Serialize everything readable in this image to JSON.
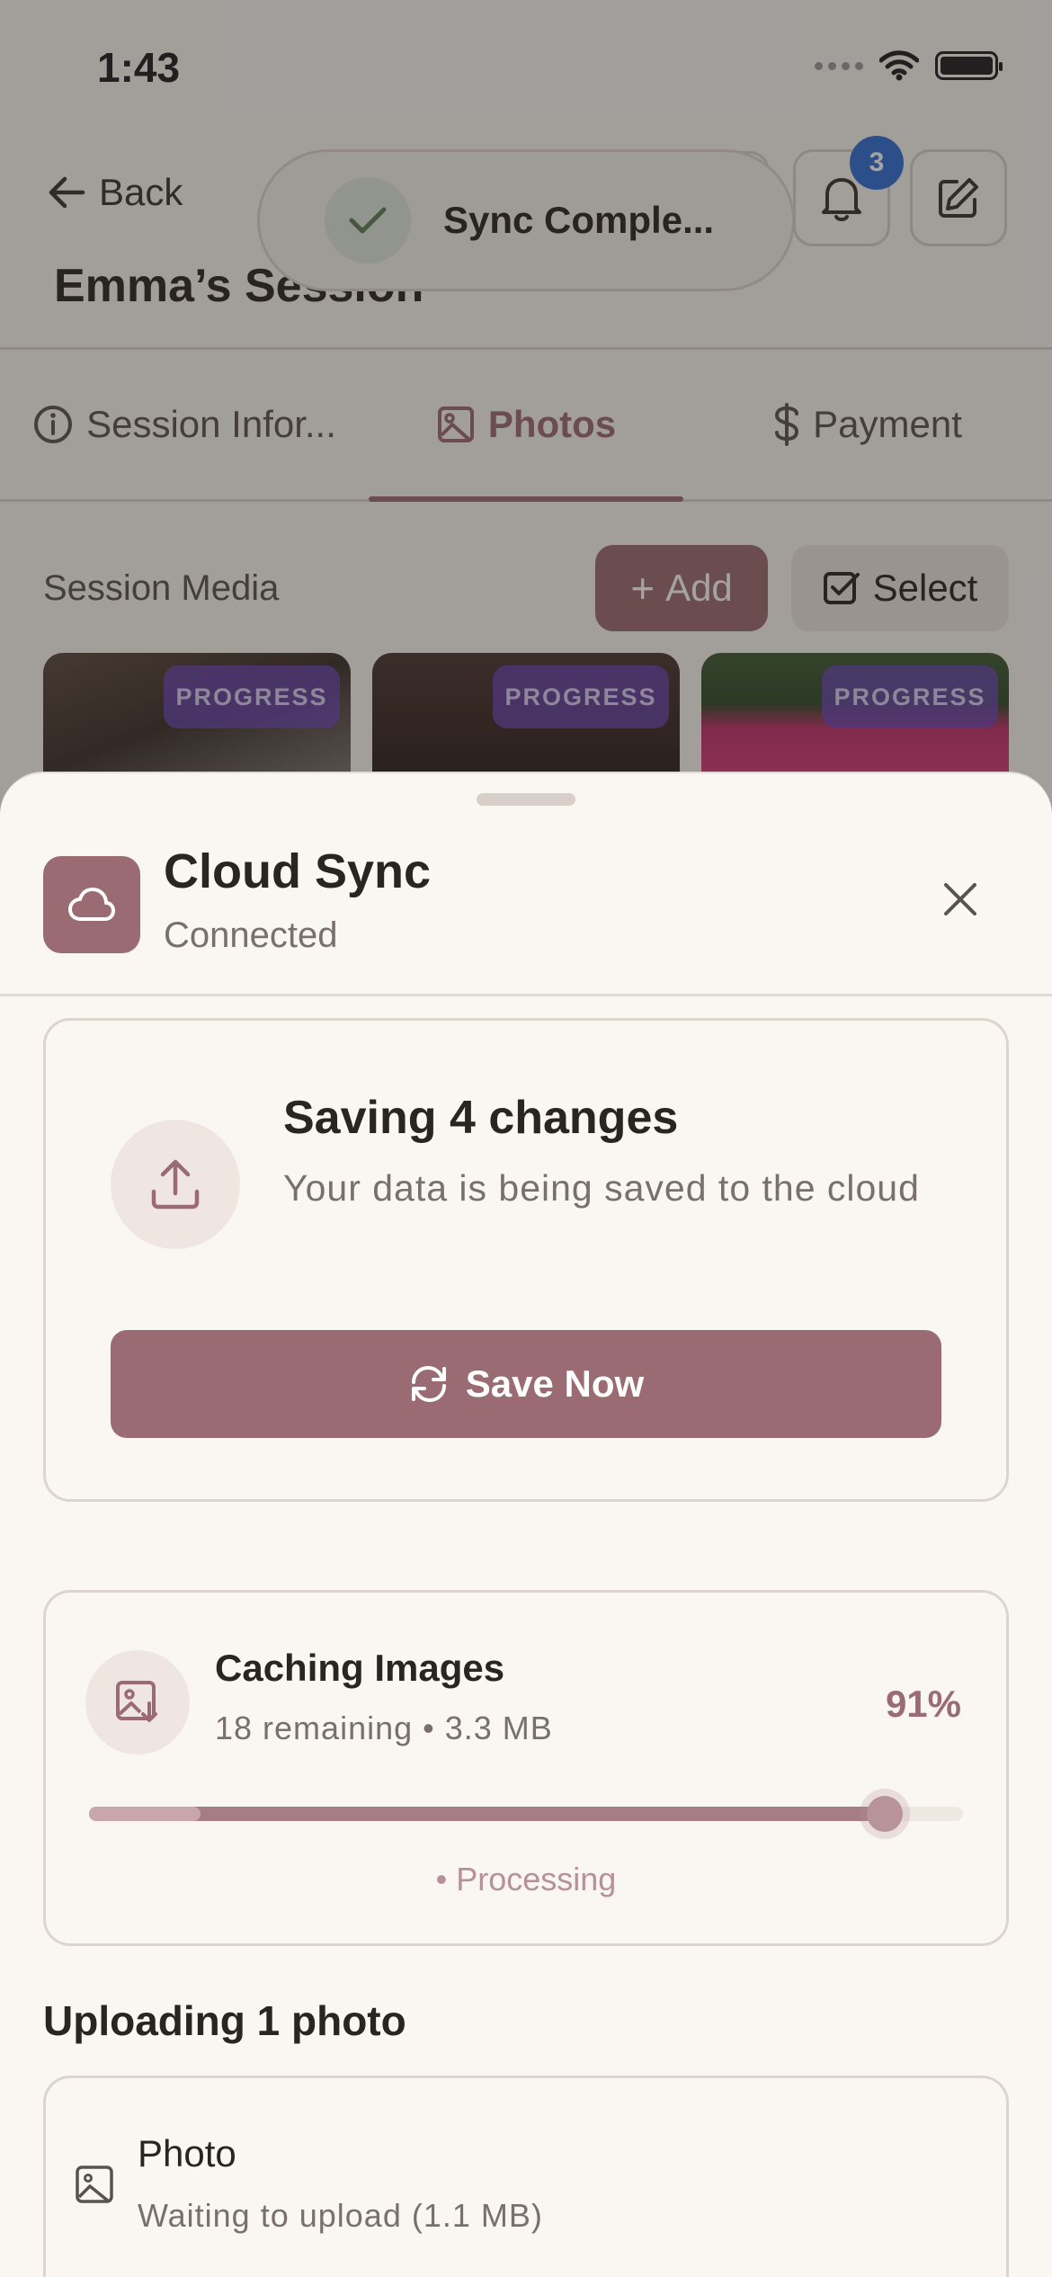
{
  "status_bar": {
    "time": "1:43"
  },
  "header": {
    "back_label": "Back",
    "title": "Emma’s Session",
    "notification_count": "3"
  },
  "toast": {
    "text": "Sync Comple..."
  },
  "tabs": [
    {
      "label": "Session Infor...",
      "icon": "info-icon"
    },
    {
      "label": "Photos",
      "icon": "image-icon",
      "active": true
    },
    {
      "label": "Payment",
      "icon": "dollar-icon"
    }
  ],
  "media": {
    "title": "Session Media",
    "add_label": "Add",
    "select_label": "Select",
    "thumbnails": [
      {
        "badge": "PROGRESS"
      },
      {
        "badge": "PROGRESS"
      },
      {
        "badge": "PROGRESS"
      }
    ]
  },
  "sheet": {
    "title": "Cloud Sync",
    "subtitle": "Connected",
    "save": {
      "title": "Saving 4 changes",
      "description": "Your data is being saved to the cloud",
      "button_label": "Save Now"
    },
    "cache": {
      "title": "Caching Images",
      "meta": "18 remaining • 3.3 MB",
      "percent_label": "91%",
      "progress": 0.91,
      "status": "• Processing"
    },
    "uploads": {
      "heading": "Uploading 1 photo",
      "items": [
        {
          "name": "Photo",
          "status": "Waiting to upload (1.1 MB)"
        }
      ]
    }
  },
  "colors": {
    "accent": "#9b6b73",
    "badge_blue": "#2f6fd6",
    "progress_badge": "#6e46be"
  }
}
